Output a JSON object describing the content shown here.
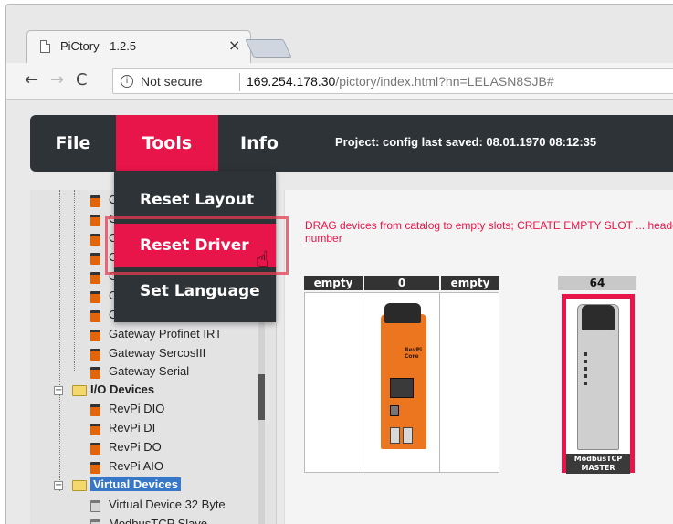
{
  "browser": {
    "tab_title": "PiCtory - 1.2.5",
    "tab_close": "×",
    "security_label": "Not secure",
    "url_host": "169.254.178.30",
    "url_path": "/pictory/index.html?hn=LELASN8SJB#",
    "nav": {
      "back": "←",
      "forward": "→",
      "reload": "C"
    }
  },
  "app": {
    "menu": {
      "file": "File",
      "tools": "Tools",
      "info": "Info"
    },
    "project_status": "Project: config last saved: 08.01.1970 08:12:35",
    "tools_menu": [
      "Reset Layout",
      "Reset Driver",
      "Set Language"
    ],
    "hint": "DRAG devices from catalog to empty slots; CREATE EMPTY SLOT ... header number"
  },
  "tree": {
    "gateways": [
      {
        "label": "C"
      },
      {
        "label": "C"
      },
      {
        "label": "C"
      },
      {
        "label": "C"
      },
      {
        "label": "C"
      },
      {
        "label": "C"
      },
      {
        "label": "C"
      },
      {
        "label": "Gateway Profinet IRT"
      },
      {
        "label": "Gateway SercosIII"
      },
      {
        "label": "Gateway Serial"
      }
    ],
    "io_category": "I/O Devices",
    "io_devices": [
      "RevPi DIO",
      "RevPi DI",
      "RevPi DO",
      "RevPi AIO"
    ],
    "virtual_category": "Virtual Devices",
    "virtual_devices": [
      "Virtual Device 32 Byte",
      "ModbusTCP Slave"
    ]
  },
  "rack": {
    "slots": [
      "empty",
      "0",
      "empty"
    ],
    "master_slot": "64",
    "master_label": "ModbusTCP\nMASTER",
    "device_brand": "RevPi\nCore"
  }
}
